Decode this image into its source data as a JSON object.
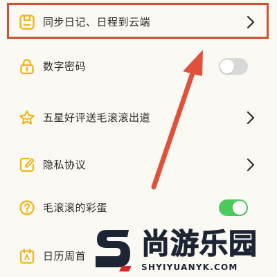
{
  "settings": {
    "items": [
      {
        "label": "同步日记、日程到云端",
        "icon": "cloud-save-icon",
        "control": "chevron"
      },
      {
        "label": "数字密码",
        "icon": "lock-icon",
        "control": "toggle",
        "toggle_on": false
      },
      {
        "label": "五星好评送毛滚滚出道",
        "icon": "star-icon",
        "control": "chevron"
      },
      {
        "label": "隐私协议",
        "icon": "edit-document-icon",
        "control": "chevron"
      },
      {
        "label": "毛滚滚的彩蛋",
        "icon": "question-icon",
        "control": "toggle",
        "toggle_on": true
      },
      {
        "label": "日历周首",
        "icon": "calendar-icon",
        "control": "none"
      }
    ]
  },
  "annotation": {
    "highlight_color": "#d1512f",
    "arrow_color": "#e0503a"
  },
  "colors": {
    "icon_yellow": "#f2b51c",
    "toggle_on": "#4ccb5c",
    "toggle_off": "#d9d9d9",
    "chevron": "#2b2b2b"
  },
  "watermark": {
    "name": "尚游乐园",
    "domain": "SHYIYUANYK.COM"
  }
}
